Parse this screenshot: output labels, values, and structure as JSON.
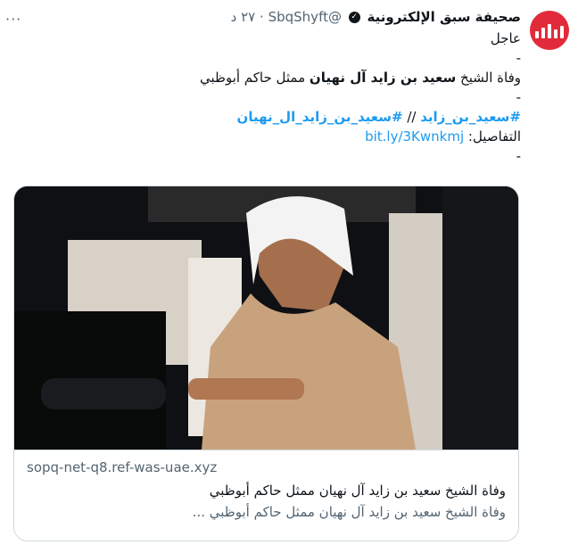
{
  "account": {
    "name": "صحيفة سبق الإلكترونية",
    "handle": "@SbqShyft",
    "time": "٢٧ د",
    "separator": "·",
    "more_glyph": "···",
    "verified_glyph": "✓",
    "avatar_color": "#e22b3a"
  },
  "tweet": {
    "label": "عاجل",
    "dash": "-",
    "headline_prefix": "وفاة الشيخ ",
    "headline_bold": "سعيد بن زايد آل نهيان",
    "headline_suffix": " ممثل حاكم أبوظبي",
    "hashtag1": "#سعيد_بن_زايد",
    "hashtag_sep": " // ",
    "hashtag2": "#سعيد_بن_زايد_ال_نهيان",
    "details_label": "التفاصيل: ",
    "details_link": "bit.ly/3Kwnkmj"
  },
  "card": {
    "domain": "sopq-net-q8.ref-was-uae.xyz",
    "title": "وفاة الشيخ سعيد بن زايد آل نهيان ممثل حاكم أبوظبي",
    "description": "وفاة الشيخ سعيد بن زايد آل نهيان ممثل حاكم أبوظبي ..."
  },
  "colors": {
    "link": "#1d9bf0",
    "muted": "#536471",
    "border": "#cfd9de"
  }
}
